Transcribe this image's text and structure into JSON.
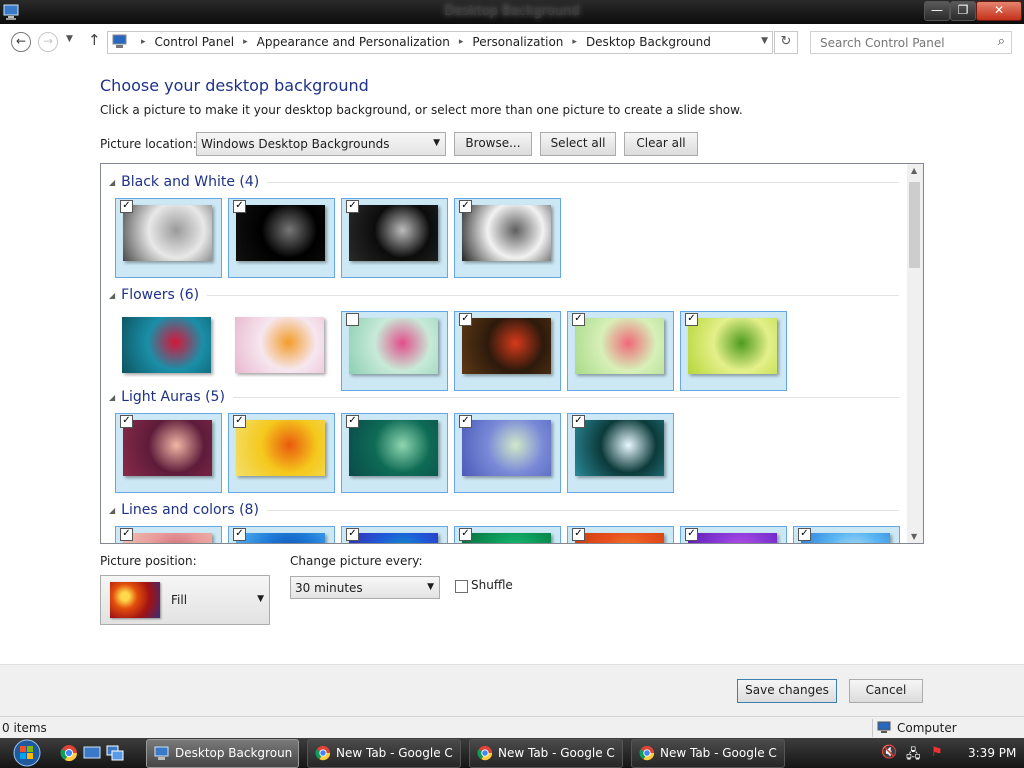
{
  "window": {
    "title": "Desktop Background",
    "min_glyph": "—",
    "max_glyph": "❐",
    "close_glyph": "✕"
  },
  "address": {
    "crumbs": [
      "Control Panel",
      "Appearance and Personalization",
      "Personalization",
      "Desktop Background"
    ],
    "search_placeholder": "Search Control Panel"
  },
  "content": {
    "heading": "Choose your desktop background",
    "subheading": "Click a picture to make it your desktop background, or select more than one picture to create a slide show.",
    "picture_location_label": "Picture location:",
    "picture_location_value": "Windows Desktop Backgrounds",
    "browse_label": "Browse...",
    "select_all_label": "Select all",
    "clear_all_label": "Clear all"
  },
  "gallery": {
    "groups": [
      {
        "name": "Black and White (4)",
        "images": [
          {
            "checked": true,
            "selected": true,
            "colors": [
              "#e8e8e8",
              "#9a9a9a",
              "#4a4a4a"
            ]
          },
          {
            "checked": true,
            "selected": true,
            "colors": [
              "#000000",
              "#777777",
              "#111111"
            ]
          },
          {
            "checked": true,
            "selected": true,
            "colors": [
              "#0c0c0c",
              "#bdbdbd",
              "#2a2a2a"
            ]
          },
          {
            "checked": true,
            "selected": true,
            "colors": [
              "#f2f2f2",
              "#5e5e5e",
              "#222222"
            ]
          }
        ]
      },
      {
        "name": "Flowers (6)",
        "images": [
          {
            "checked": false,
            "selected": false,
            "colors": [
              "#1a8fa8",
              "#d4173a",
              "#0d5360"
            ]
          },
          {
            "checked": false,
            "selected": false,
            "colors": [
              "#f6e7ef",
              "#f39c2a",
              "#e9b7cf"
            ]
          },
          {
            "checked": false,
            "selected": true,
            "colors": [
              "#c8ead8",
              "#e24e8a",
              "#8ccfb3"
            ]
          },
          {
            "checked": true,
            "selected": true,
            "colors": [
              "#2d1a0c",
              "#d73a1a",
              "#5e3915"
            ]
          },
          {
            "checked": true,
            "selected": true,
            "colors": [
              "#d7f0b8",
              "#f06a7a",
              "#a8da8a"
            ]
          },
          {
            "checked": true,
            "selected": true,
            "colors": [
              "#e4f08a",
              "#4e9b1e",
              "#b6d63a"
            ]
          }
        ]
      },
      {
        "name": "Light Auras (5)",
        "images": [
          {
            "checked": true,
            "selected": true,
            "colors": [
              "#5e1c3a",
              "#f3b7a5",
              "#8a2a4a"
            ]
          },
          {
            "checked": true,
            "selected": true,
            "colors": [
              "#f5c81c",
              "#e95a0e",
              "#f2e06a"
            ]
          },
          {
            "checked": true,
            "selected": true,
            "colors": [
              "#0e6b55",
              "#8fd6b0",
              "#0a4a4a"
            ]
          },
          {
            "checked": true,
            "selected": true,
            "colors": [
              "#7a8ad8",
              "#d0e8c8",
              "#4a5ab8"
            ]
          },
          {
            "checked": true,
            "selected": true,
            "colors": [
              "#0c3a3a",
              "#e8f8ff",
              "#2a8a9a"
            ]
          }
        ]
      },
      {
        "name": "Lines and colors (8)",
        "images": [
          {
            "checked": true,
            "selected": true,
            "colors": [
              "#e89a9a",
              "#c85a6a",
              "#f2c2b2"
            ]
          },
          {
            "checked": true,
            "selected": true,
            "colors": [
              "#1e7bd8",
              "#0c4ab0",
              "#5ab6f2"
            ]
          },
          {
            "checked": true,
            "selected": true,
            "colors": [
              "#1e5ad8",
              "#0ca8c8",
              "#3a2ab0"
            ]
          },
          {
            "checked": true,
            "selected": true,
            "colors": [
              "#0c9a5a",
              "#1ec87a",
              "#0a6a3a"
            ]
          },
          {
            "checked": true,
            "selected": true,
            "colors": [
              "#e8501e",
              "#f28a2a",
              "#c83a0c"
            ]
          },
          {
            "checked": true,
            "selected": true,
            "colors": [
              "#8a3ad8",
              "#c85af2",
              "#5a1ab0"
            ]
          },
          {
            "checked": true,
            "selected": true,
            "colors": [
              "#5ab6f2",
              "#c8e8f8",
              "#2a7ad8"
            ]
          }
        ]
      }
    ]
  },
  "options": {
    "picture_position_label": "Picture position:",
    "picture_position_value": "Fill",
    "change_every_label": "Change picture every:",
    "change_every_value": "30 minutes",
    "shuffle_label": "Shuffle",
    "shuffle_checked": false
  },
  "footer": {
    "save_label": "Save changes",
    "cancel_label": "Cancel"
  },
  "statusbar": {
    "items": "0 items",
    "location": "Computer"
  },
  "taskbar": {
    "tasks": [
      {
        "label": "Desktop Background",
        "active": true,
        "icon": "control-panel-icon"
      },
      {
        "label": "New Tab - Google C...",
        "active": false,
        "icon": "chrome-icon"
      },
      {
        "label": "New Tab - Google C...",
        "active": false,
        "icon": "chrome-icon"
      },
      {
        "label": "New Tab - Google C...",
        "active": false,
        "icon": "chrome-icon"
      }
    ],
    "clock": "3:39 PM"
  }
}
